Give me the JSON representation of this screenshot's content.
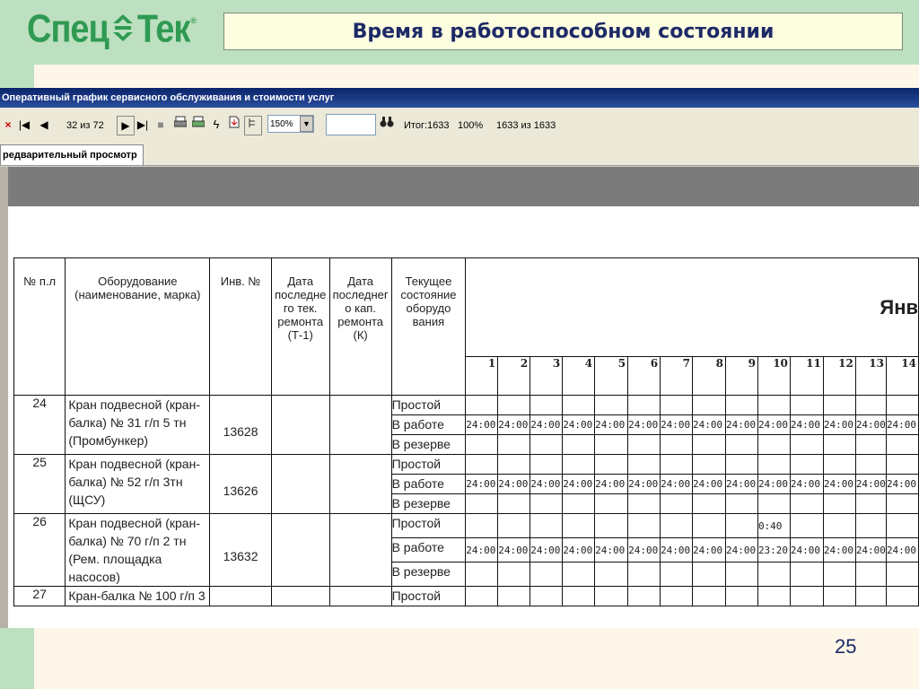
{
  "slide": {
    "logo_part1": "Спец",
    "logo_part2": "Тек",
    "logo_reg": "®",
    "title": "Время в работоспособном состоянии",
    "page_number": "25"
  },
  "window": {
    "title": "Оперативный график сервисного обслуживания и стоимости услуг",
    "toolbar": {
      "close": "×",
      "first": "|◀",
      "prev": "◀",
      "page_info": "32 из 72",
      "next": "▶",
      "last": "▶|",
      "stop": "■",
      "zoom": "150%",
      "search_icon": "binoculars",
      "total": "Итог:1633",
      "percent": "100%",
      "count": "1633 из 1633"
    },
    "tab_label": "редварительный просмотр"
  },
  "table": {
    "headers": {
      "num": "№ п.л",
      "equipment": "Оборудование (наименование, марка)",
      "inv": "Инв. №",
      "date_t1": "Дата последне го тек. ремонта (Т-1)",
      "date_k": "Дата последнег о кап. ремонта (К)",
      "state": "Текущее состояние оборудо вания",
      "month": "Янв"
    },
    "days": [
      "1",
      "2",
      "3",
      "4",
      "5",
      "6",
      "7",
      "8",
      "9",
      "10",
      "11",
      "12",
      "13",
      "14"
    ],
    "status_labels": [
      "Простой",
      "В работе",
      "В резерве"
    ],
    "rows": [
      {
        "num": "24",
        "equipment": "Кран подвесной (кран-балка) № 31 г/п 5 тн (Промбункер)",
        "inv": "13628",
        "idle": [
          "",
          "",
          "",
          "",
          "",
          "",
          "",
          "",
          "",
          "",
          "",
          "",
          "",
          ""
        ],
        "work": [
          "24:00",
          "24:00",
          "24:00",
          "24:00",
          "24:00",
          "24:00",
          "24:00",
          "24:00",
          "24:00",
          "24:00",
          "24:00",
          "24:00",
          "24:00",
          "24:00"
        ]
      },
      {
        "num": "25",
        "equipment": "Кран подвесной (кран-балка) № 52 г/п 3тн (ЩСУ)",
        "inv": "13626",
        "idle": [
          "",
          "",
          "",
          "",
          "",
          "",
          "",
          "",
          "",
          "",
          "",
          "",
          "",
          ""
        ],
        "work": [
          "24:00",
          "24:00",
          "24:00",
          "24:00",
          "24:00",
          "24:00",
          "24:00",
          "24:00",
          "24:00",
          "24:00",
          "24:00",
          "24:00",
          "24:00",
          "24:00"
        ]
      },
      {
        "num": "26",
        "equipment": "Кран подвесной (кран-балка) № 70 г/п 2 тн (Рем. площадка насосов)",
        "inv": "13632",
        "idle": [
          "",
          "",
          "",
          "",
          "",
          "",
          "",
          "",
          "",
          "0:40",
          "",
          "",
          "",
          ""
        ],
        "work": [
          "24:00",
          "24:00",
          "24:00",
          "24:00",
          "24:00",
          "24:00",
          "24:00",
          "24:00",
          "24:00",
          "23:20",
          "24:00",
          "24:00",
          "24:00",
          "24:00"
        ]
      },
      {
        "num": "27",
        "equipment": "Кран-балка № 100 г/п 3",
        "inv": "",
        "idle": [
          "",
          "",
          "",
          "",
          "",
          "",
          "",
          "",
          "",
          "",
          "",
          "",
          "",
          ""
        ],
        "work": []
      }
    ]
  },
  "chart_data": {
    "type": "table",
    "title": "Время в работоспособном состоянии",
    "columns": [
      "№ п.л",
      "Оборудование (наименование, марка)",
      "Инв. №",
      "Дата последнего тек. ремонта (Т-1)",
      "Дата последнего кап. ремонта (К)",
      "Текущее состояние оборудования",
      "1",
      "2",
      "3",
      "4",
      "5",
      "6",
      "7",
      "8",
      "9",
      "10",
      "11",
      "12",
      "13",
      "14"
    ],
    "rows": [
      [
        "24",
        "Кран подвесной (кран-балка) № 31 г/п 5 тн (Промбункер)",
        "13628",
        "",
        "",
        "В работе",
        "24:00",
        "24:00",
        "24:00",
        "24:00",
        "24:00",
        "24:00",
        "24:00",
        "24:00",
        "24:00",
        "24:00",
        "24:00",
        "24:00",
        "24:00",
        "24:00"
      ],
      [
        "25",
        "Кран подвесной (кран-балка) № 52 г/п 3тн (ЩСУ)",
        "13626",
        "",
        "",
        "В работе",
        "24:00",
        "24:00",
        "24:00",
        "24:00",
        "24:00",
        "24:00",
        "24:00",
        "24:00",
        "24:00",
        "24:00",
        "24:00",
        "24:00",
        "24:00",
        "24:00"
      ],
      [
        "26",
        "Кран подвесной (кран-балка) № 70 г/п 2 тн (Рем. площадка насосов)",
        "13632",
        "",
        "",
        "Простой",
        "",
        "",
        "",
        "",
        "",
        "",
        "",
        "",
        "",
        "0:40",
        "",
        "",
        "",
        ""
      ],
      [
        "26",
        "Кран подвесной (кран-балка) № 70 г/п 2 тн (Рем. площадка насосов)",
        "13632",
        "",
        "",
        "В работе",
        "24:00",
        "24:00",
        "24:00",
        "24:00",
        "24:00",
        "24:00",
        "24:00",
        "24:00",
        "24:00",
        "23:20",
        "24:00",
        "24:00",
        "24:00",
        "24:00"
      ]
    ]
  }
}
